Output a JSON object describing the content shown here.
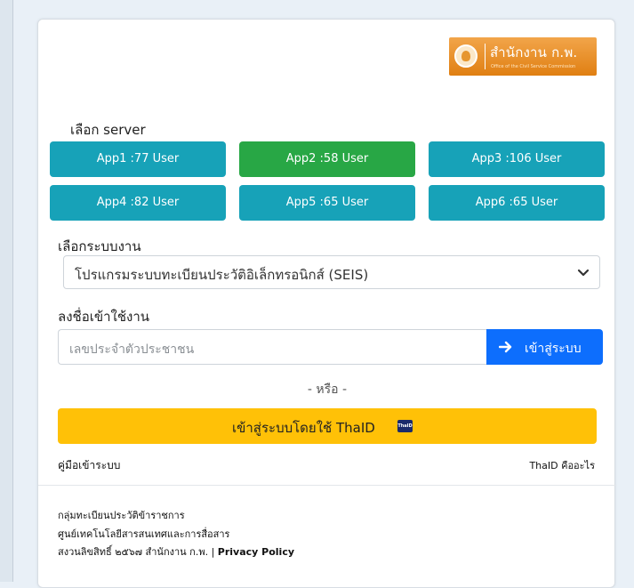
{
  "logo": {
    "main": "สำนักงาน ก.พ.",
    "sub": "Office of the Civil Service Commission"
  },
  "server_section": {
    "label": "เลือก server",
    "servers": [
      {
        "label": "App1 :77 User",
        "active": false
      },
      {
        "label": "App2 :58 User",
        "active": true
      },
      {
        "label": "App3 :106 User",
        "active": false
      },
      {
        "label": "App4 :82 User",
        "active": false
      },
      {
        "label": "App5 :65 User",
        "active": false
      },
      {
        "label": "App6 :65 User",
        "active": false
      }
    ]
  },
  "system_section": {
    "label": "เลือกระบบงาน",
    "selected": "โปรแกรมระบบทะเบียนประวัติอิเล็กทรอนิกส์ (SEIS)"
  },
  "login_section": {
    "label": "ลงชื่อเข้าใช้งาน",
    "placeholder": "เลขประจำตัวประชาชน",
    "button_label": "เข้าสู่ระบบ"
  },
  "or_text": "- หรือ -",
  "thaid_button": {
    "label": "เข้าสู่ระบบโดยใช้ ThaID",
    "badge": "ThaID"
  },
  "links": {
    "manual": "คู่มือเข้าระบบ",
    "thaid_info": "ThaID คืออะไร"
  },
  "footer": {
    "line1": "กลุ่มทะเบียนประวัติข้าราชการ",
    "line2": "ศูนย์เทคโนโลยีสารสนเทศและการสื่อสาร",
    "copyright": "สงวนลิขสิทธิ์ ๒๕๖๗ สำนักงาน ก.พ. |",
    "privacy": "Privacy Policy"
  },
  "colors": {
    "server_default": "#17a2b8",
    "server_active": "#28a745",
    "primary": "#0d6efd",
    "thaid": "#ffc107",
    "logo": "#e8901f"
  }
}
